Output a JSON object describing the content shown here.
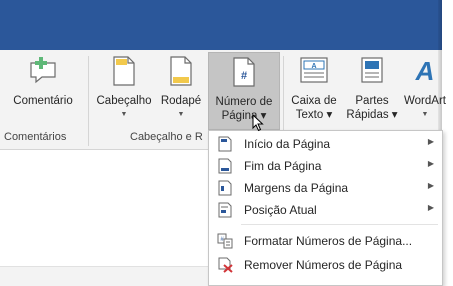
{
  "ribbon": {
    "buttons": [
      {
        "label": "Comentário",
        "label2": "",
        "has_caret": false
      },
      {
        "label": "Cabeçalho",
        "label2": "",
        "has_caret": true
      },
      {
        "label": "Rodapé",
        "label2": "",
        "has_caret": true
      },
      {
        "label": "Número de",
        "label2": "Página ▾",
        "has_caret": false
      },
      {
        "label": "Caixa de",
        "label2": "Texto ▾",
        "has_caret": false
      },
      {
        "label": "Partes",
        "label2": "Rápidas ▾",
        "has_caret": false
      },
      {
        "label": "WordArt",
        "label2": "",
        "has_caret": true
      }
    ],
    "groups": {
      "comments": "Comentários",
      "header_footer": "Cabeçalho e R"
    }
  },
  "menu": {
    "items": [
      {
        "label": "Início da Página",
        "icon": "page-top-icon",
        "submenu": true
      },
      {
        "label": "Fim da Página",
        "icon": "page-bottom-icon",
        "submenu": true
      },
      {
        "label": "Margens da Página",
        "icon": "page-margins-icon",
        "submenu": true
      },
      {
        "label": "Posição Atual",
        "icon": "current-position-icon",
        "submenu": true
      },
      {
        "label": "Formatar Números de Página...",
        "icon": "format-page-numbers-icon",
        "submenu": false
      },
      {
        "label": "Remover Números de Página",
        "icon": "remove-page-numbers-icon",
        "submenu": false
      }
    ],
    "submenu_arrow": "▶"
  },
  "colors": {
    "title_bar": "#2b579a",
    "ribbon_bg": "#f3f3f3",
    "accent_blue": "#2b579a",
    "wordart_blue": "#2e74b5",
    "remove_red": "#d13438",
    "comment_green": "#5fb878"
  }
}
